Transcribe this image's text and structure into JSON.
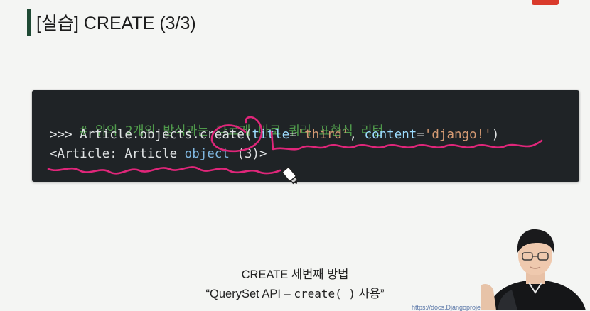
{
  "slide": {
    "title": "[실습] CREATE (3/3)"
  },
  "code": {
    "line1": "# 위의 2개의 방식과는 다르게 바로 쿼리 표현식 리턴",
    "line2": {
      "prompt": ">>> ",
      "call": "Article.objects.create(",
      "param1": "title",
      "eq1": "=",
      "val1": "'third'",
      "sep": ", ",
      "param2": "content",
      "eq2": "=",
      "val2": "'django!'",
      "close": ")"
    },
    "line3": {
      "open": "<Article: Article ",
      "obj": "object",
      "close": " (3)>"
    }
  },
  "caption": {
    "line1": "CREATE 세번째 방법",
    "line2_pre": "“QuerySet API – ",
    "line2_code": "create( )",
    "line2_post": " 사용”"
  },
  "footer": {
    "url": "https://docs.Djangoprojec"
  },
  "colors": {
    "title_accent": "#1f4a34",
    "code_bg": "#1f2326",
    "annotation_pen": "#e0267a",
    "live_badge": "#d93a2b"
  },
  "icons": {
    "cursor": "highlighter-cursor-icon",
    "live": "live-badge"
  }
}
